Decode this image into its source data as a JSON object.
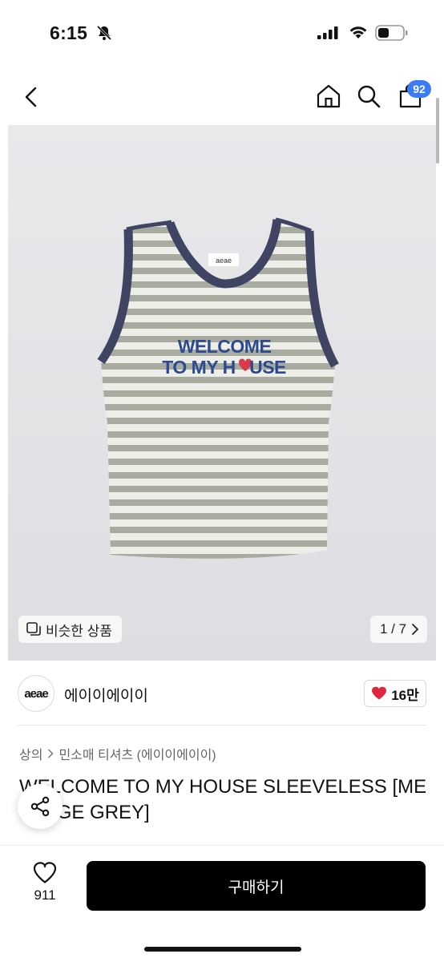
{
  "status_bar": {
    "time": "6:15"
  },
  "header": {
    "cart_count": "92"
  },
  "gallery": {
    "similar_label": "비슷한 상품",
    "counter": "1 / 7",
    "print_line1": "WELCOME",
    "print_line2_a": "TO MY H",
    "print_line2_b": "USE",
    "tag_text": "aeae"
  },
  "brand": {
    "logo_text": "aeae",
    "name": "에이이에이이",
    "like_count": "16만"
  },
  "breadcrumb": {
    "category": "상의",
    "subcategory": "민소매 티셔츠 (에이이에이이)"
  },
  "product": {
    "title": "WELCOME TO MY HOUSE SLEEVELESS [MELANGE GREY]"
  },
  "bottom_bar": {
    "wish_count": "911",
    "buy_label": "구매하기"
  },
  "colors": {
    "accent_blue": "#3b7bf6",
    "heart_red": "#e0263c",
    "navy_trim": "#3e4461",
    "stripe_grey": "#a8ab9f"
  }
}
